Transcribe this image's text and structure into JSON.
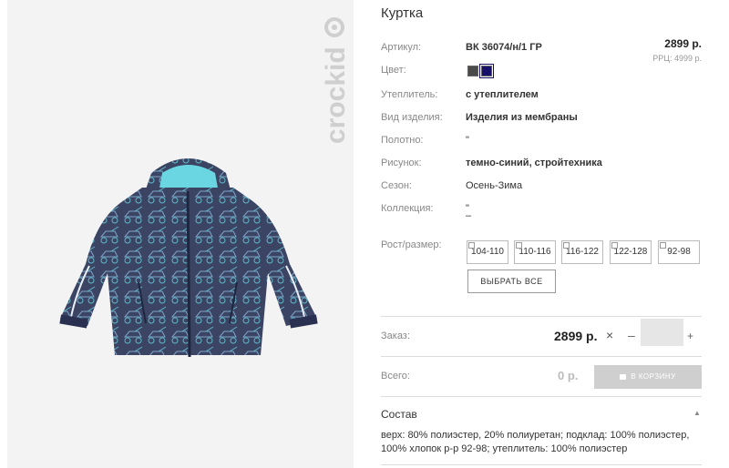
{
  "product": {
    "title": "Куртка",
    "price": "2899 р.",
    "rrp": "РРЦ: 4999 р."
  },
  "brand": {
    "logo_text": "crockid"
  },
  "attributes": {
    "article_label": "Артикул:",
    "article_value": "ВК 36074/н/1 ГР",
    "color_label": "Цвет:",
    "insulation_label": "Утеплитель:",
    "insulation_value": "с утеплителем",
    "type_label": "Вид изделия:",
    "type_value": "Изделия из мембраны",
    "fabric_label": "Полотно:",
    "fabric_value": "\"",
    "pattern_label": "Рисунок:",
    "pattern_value": "темно-синий, стройтехника",
    "season_label": "Сезон:",
    "season_value": "Осень-Зима",
    "collection_label": "Коллекция:",
    "collection_value": "\"",
    "collection_value2": "–"
  },
  "colors": [
    {
      "name": "dark-gray",
      "hex": "#4a4a4a"
    },
    {
      "name": "navy",
      "hex": "#16106a",
      "selected": true
    }
  ],
  "sizes": {
    "label": "Рост/размер:",
    "options": [
      "104-110",
      "110-116",
      "116-122",
      "122-128",
      "92-98"
    ],
    "select_all": "ВЫБРАТЬ ВСЕ"
  },
  "order": {
    "label": "Заказ:",
    "price": "2899 р.",
    "times": "×",
    "minus": "–",
    "quantity": "",
    "plus": "+"
  },
  "total": {
    "label": "Всего:",
    "value": "0 р.",
    "cart_button": "В КОРЗИНУ"
  },
  "composition": {
    "title": "Состав",
    "toggle": "▲",
    "text": "верх: 80% полиэстер, 20% полиуретан; подклад: 100% полиэстер, 100% хлопок р-р 92-98; утеплитель: 100% полиэстер"
  }
}
